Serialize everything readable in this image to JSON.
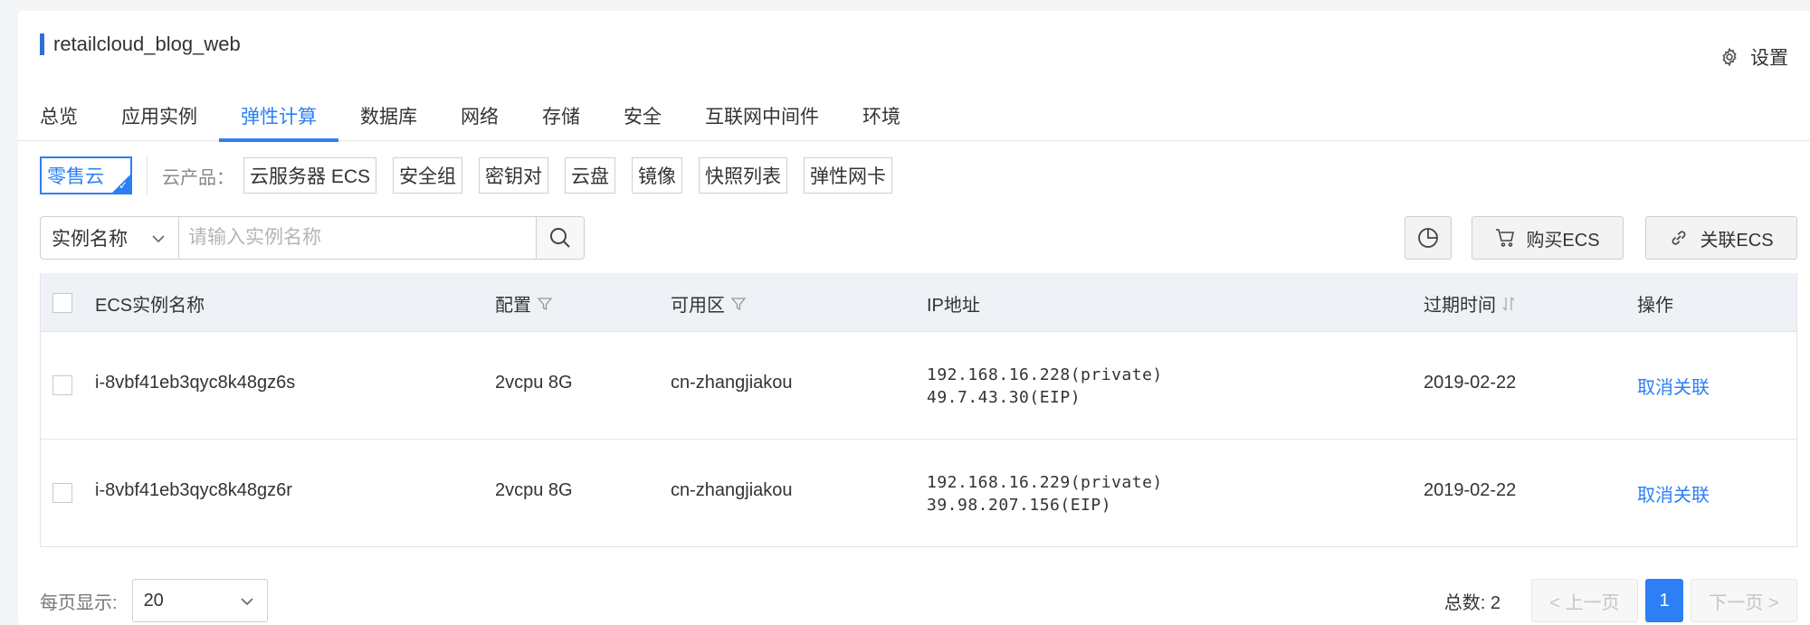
{
  "app": {
    "title": "retailcloud_blog_web",
    "settings_label": "设置"
  },
  "tabs": [
    {
      "label": "总览"
    },
    {
      "label": "应用实例"
    },
    {
      "label": "弹性计算",
      "active": true
    },
    {
      "label": "数据库"
    },
    {
      "label": "网络"
    },
    {
      "label": "存储"
    },
    {
      "label": "安全"
    },
    {
      "label": "互联网中间件"
    },
    {
      "label": "环境"
    }
  ],
  "filters": {
    "cloud": "零售云",
    "products_label": "云产品：",
    "products": [
      "云服务器 ECS",
      "安全组",
      "密钥对",
      "云盘",
      "镜像",
      "快照列表",
      "弹性网卡"
    ]
  },
  "search": {
    "field": "实例名称",
    "placeholder": "请输入实例名称"
  },
  "actions": {
    "buy": "购买ECS",
    "link": "关联ECS"
  },
  "table": {
    "columns": {
      "name": "ECS实例名称",
      "config": "配置",
      "zone": "可用区",
      "ip": "IP地址",
      "expire": "过期时间",
      "op": "操作"
    },
    "rows": [
      {
        "name": "i-8vbf41eb3qyc8k48gz6s",
        "config": "2vcpu 8G",
        "zone": "cn-zhangjiakou",
        "ip_private": "192.168.16.228(private)",
        "ip_eip": "49.7.43.30(EIP)",
        "expire": "2019-02-22",
        "op": "取消关联"
      },
      {
        "name": "i-8vbf41eb3qyc8k48gz6r",
        "config": "2vcpu 8G",
        "zone": "cn-zhangjiakou",
        "ip_private": "192.168.16.229(private)",
        "ip_eip": "39.98.207.156(EIP)",
        "expire": "2019-02-22",
        "op": "取消关联"
      }
    ]
  },
  "footer": {
    "perpage_label": "每页显示:",
    "perpage_value": "20",
    "total_label": "总数: 2",
    "prev": "< 上一页",
    "current_page": "1",
    "next": "下一页 >"
  },
  "colors": {
    "accent": "#2c7ff5",
    "title_bar": "#2c6fd6",
    "header_bg": "#eef1f6"
  }
}
